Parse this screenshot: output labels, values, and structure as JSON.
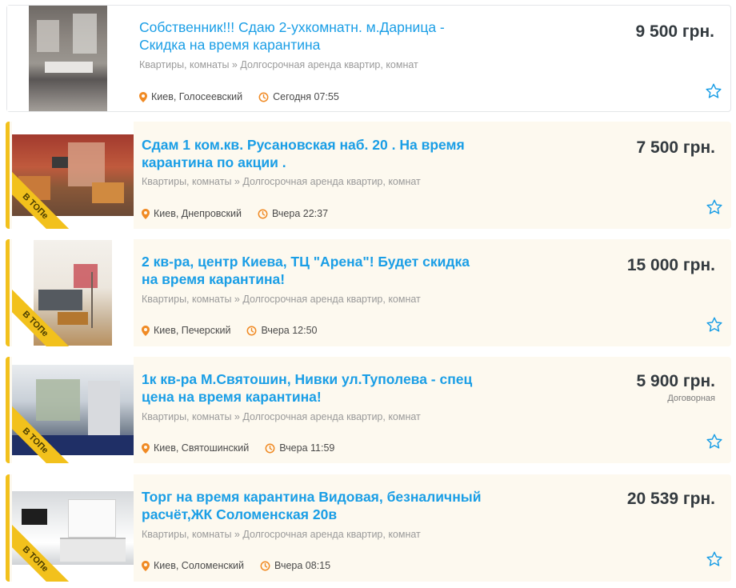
{
  "listings": [
    {
      "title": "Собственник!!! Сдаю 2-ухкомнатн. м.Дарница - Скидка на время карантина",
      "category": "Квартиры, комнаты » Долгосрочная аренда квартир, комнат",
      "location": "Киев, Голосеевский",
      "time": "Сегодня 07:55",
      "price": "9 500 грн.",
      "promoted": false
    },
    {
      "title": "Сдам 1 ком.кв. Русановская наб. 20 . На время карантина по акции .",
      "category": "Квартиры, комнаты » Долгосрочная аренда квартир, комнат",
      "location": "Киев, Днепровский",
      "time": "Вчера 22:37",
      "price": "7 500 грн.",
      "promoted": true,
      "badge": "В ТОПе"
    },
    {
      "title": "2 кв-ра, центр Киева, ТЦ \"Арена\"! Будет скидка на время карантина!",
      "category": "Квартиры, комнаты » Долгосрочная аренда квартир, комнат",
      "location": "Киев, Печерский",
      "time": "Вчера 12:50",
      "price": "15 000 грн.",
      "promoted": true,
      "badge": "В ТОПе"
    },
    {
      "title": "1к кв-ра М.Святошин, Нивки ул.Туполева - спец цена на время карантина!",
      "category": "Квартиры, комнаты » Долгосрочная аренда квартир, комнат",
      "location": "Киев, Святошинский",
      "time": "Вчера 11:59",
      "price": "5 900 грн.",
      "price_note": "Договорная",
      "promoted": true,
      "badge": "В ТОПе"
    },
    {
      "title": "Торг на время карантина Видовая, безналичный расчёт,ЖК Соломенская 20в",
      "category": "Квартиры, комнаты » Долгосрочная аренда квартир, комнат",
      "location": "Киев, Соломенский",
      "time": "Вчера 08:15",
      "price": "20 539 грн.",
      "promoted": true,
      "badge": "В ТОПе"
    }
  ],
  "colors": {
    "title": "#1a9ee6",
    "promo_background": "#fdf9ef",
    "promo_accent": "#f2c11c",
    "icon_accent": "#f08a24",
    "star": "#1a9ee6"
  },
  "icons": {
    "location": "map-pin-icon",
    "time": "clock-icon",
    "favorite": "star-outline-icon"
  }
}
